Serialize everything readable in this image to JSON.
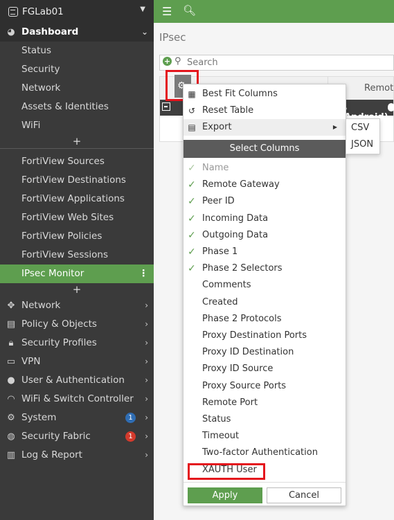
{
  "device": {
    "name": "FGLab01"
  },
  "sidebar": {
    "dashboard": "Dashboard",
    "dashboard_items": [
      "Status",
      "Security",
      "Network",
      "Assets & Identities",
      "WiFi"
    ],
    "fortiview_items": [
      "FortiView Sources",
      "FortiView Destinations",
      "FortiView Applications",
      "FortiView Web Sites",
      "FortiView Policies",
      "FortiView Sessions"
    ],
    "active_item": "IPsec Monitor",
    "nav_items": [
      {
        "label": "Network",
        "icon": "network-icon"
      },
      {
        "label": "Policy & Objects",
        "icon": "policy-icon"
      },
      {
        "label": "Security Profiles",
        "icon": "lock-icon"
      },
      {
        "label": "VPN",
        "icon": "monitor-icon"
      },
      {
        "label": "User & Authentication",
        "icon": "user-icon"
      },
      {
        "label": "WiFi & Switch Controller",
        "icon": "wifi-icon"
      },
      {
        "label": "System",
        "icon": "gear-icon",
        "badge": "1"
      },
      {
        "label": "Security Fabric",
        "icon": "fabric-icon",
        "badge": "1"
      },
      {
        "label": "Log & Report",
        "icon": "chart-icon"
      }
    ],
    "plus": "+"
  },
  "main": {
    "title": "IPsec",
    "search_placeholder": "Search",
    "column_header": "Remote",
    "group_row": ", Android)"
  },
  "menu": {
    "best_fit": "Best Fit Columns",
    "reset_table": "Reset Table",
    "export": "Export",
    "select_columns": "Select Columns",
    "columns": [
      {
        "label": "Name",
        "checked": true,
        "disabled": true
      },
      {
        "label": "Remote Gateway",
        "checked": true
      },
      {
        "label": "Peer ID",
        "checked": true
      },
      {
        "label": "Incoming Data",
        "checked": true
      },
      {
        "label": "Outgoing Data",
        "checked": true
      },
      {
        "label": "Phase 1",
        "checked": true
      },
      {
        "label": "Phase 2 Selectors",
        "checked": true
      },
      {
        "label": "Comments",
        "checked": false
      },
      {
        "label": "Created",
        "checked": false
      },
      {
        "label": "Phase 2 Protocols",
        "checked": false
      },
      {
        "label": "Proxy Destination Ports",
        "checked": false
      },
      {
        "label": "Proxy ID Destination",
        "checked": false
      },
      {
        "label": "Proxy ID Source",
        "checked": false
      },
      {
        "label": "Proxy Source Ports",
        "checked": false
      },
      {
        "label": "Remote Port",
        "checked": false
      },
      {
        "label": "Status",
        "checked": false
      },
      {
        "label": "Timeout",
        "checked": false
      },
      {
        "label": "Two-factor Authentication",
        "checked": false
      },
      {
        "label": "XAUTH User",
        "checked": false
      }
    ],
    "apply": "Apply",
    "cancel": "Cancel"
  },
  "export_submenu": [
    "CSV",
    "JSON"
  ],
  "colors": {
    "accent": "#5e9e4f",
    "sidebar": "#3a3a3a",
    "highlight": "#e4141c"
  }
}
